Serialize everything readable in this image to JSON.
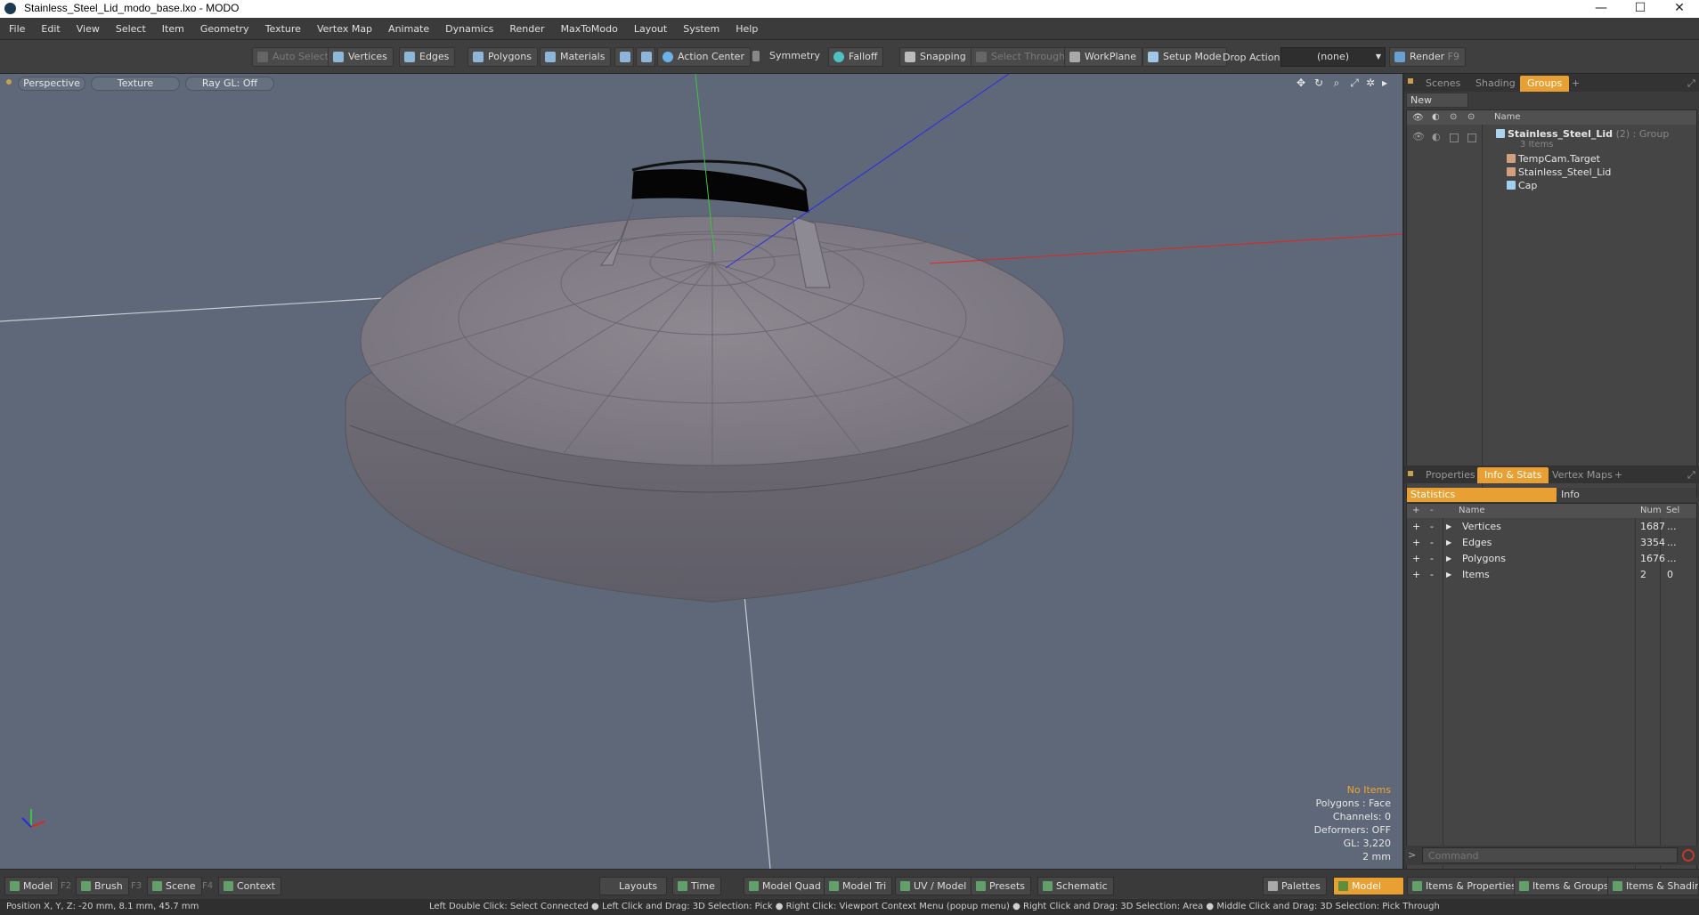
{
  "window": {
    "title": "Stainless_Steel_Lid_modo_base.lxo - MODO",
    "minimize": "—",
    "maximize": "☐",
    "close": "✕"
  },
  "menu": [
    "File",
    "Edit",
    "View",
    "Select",
    "Item",
    "Geometry",
    "Texture",
    "Vertex Map",
    "Animate",
    "Dynamics",
    "Render",
    "MaxToModo",
    "Layout",
    "System",
    "Help"
  ],
  "toolbar": {
    "auto_select": "Auto Select",
    "vertices": "Vertices",
    "edges": "Edges",
    "polygons": "Polygons",
    "materials": "Materials",
    "action_center": "Action Center",
    "symmetry": "Symmetry",
    "falloff": "Falloff",
    "snapping": "Snapping",
    "select_through": "Select Through",
    "workplane": "WorkPlane",
    "setup_mode": "Setup Mode",
    "drop_action_label": "Drop Action",
    "drop_action_value": "(none)",
    "render": "Render",
    "render_key": "F9"
  },
  "viewport": {
    "view_mode": "Perspective",
    "shading": "Texture",
    "raygl": "Ray GL: Off",
    "info": {
      "selection": "No Items",
      "polygons": "Polygons : Face",
      "channels": "Channels: 0",
      "deformers": "Deformers: OFF",
      "gl": "GL: 3,220",
      "scale": "2 mm"
    }
  },
  "scene_panel": {
    "tabs": [
      "Scenes",
      "Shading",
      "Groups"
    ],
    "active_tab": "Groups",
    "new_group": "New Group",
    "col_name": "Name",
    "group": {
      "name": "Stainless_Steel_Lid",
      "count": "(2)",
      "type": ": Group",
      "sub": "3 Items"
    },
    "items": [
      "TempCam.Target",
      "Stainless_Steel_Lid",
      "Cap"
    ]
  },
  "props_panel": {
    "tabs": [
      "Properties",
      "Info & Stats",
      "Vertex Maps"
    ],
    "active_tab": "Info & Stats",
    "subtabs": [
      "Statistics",
      "Info"
    ],
    "col_name": "Name",
    "col_num": "Num",
    "col_sel": "Sel",
    "rows": [
      {
        "name": "Vertices",
        "num": "1687",
        "sel": "..."
      },
      {
        "name": "Edges",
        "num": "3354",
        "sel": "..."
      },
      {
        "name": "Polygons",
        "num": "1676",
        "sel": "..."
      },
      {
        "name": "Items",
        "num": "2",
        "sel": "0"
      }
    ]
  },
  "command": {
    "placeholder": "Command"
  },
  "bottom": {
    "model": "Model",
    "model_key": "F2",
    "brush": "Brush",
    "brush_key": "F3",
    "scene": "Scene",
    "scene_key": "F4",
    "context": "Context",
    "layouts": "Layouts",
    "time": "Time",
    "model_quad": "Model Quad",
    "model_tri": "Model Tri",
    "uv_model": "UV / Model",
    "presets": "Presets",
    "schematic": "Schematic",
    "palettes": "Palettes",
    "model_active": "Model",
    "items_props": "Items & Properties",
    "items_groups": "Items & Groups",
    "items_shading": "Items & Shading"
  },
  "status": {
    "position": "Position X, Y, Z:   -20 mm, 8.1 mm, 45.7 mm",
    "hints": "Left Double Click: Select Connected ● Left Click and Drag: 3D Selection: Pick ● Right Click: Viewport Context Menu (popup menu) ● Right Click and Drag: 3D Selection: Area ● Middle Click and Drag: 3D Selection: Pick Through"
  },
  "colors": {
    "accent": "#e9a032",
    "viewport_bg": "#5e6878",
    "panel_bg": "#3b3b3b"
  }
}
